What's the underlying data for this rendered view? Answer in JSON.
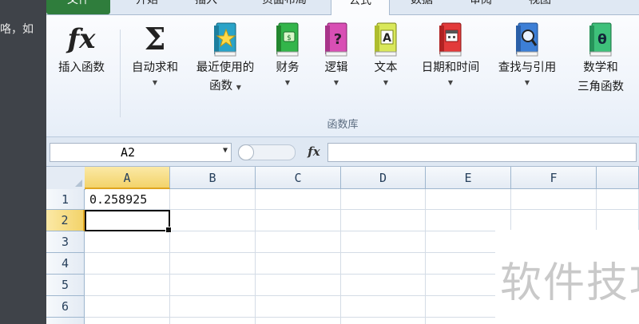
{
  "background_text": "咯，如",
  "tabs": [
    "文件",
    "开始",
    "插入",
    "页面布局",
    "公式",
    "数据",
    "审阅",
    "视图"
  ],
  "active_tab": "公式",
  "ribbon": {
    "buttons": [
      {
        "label": "插入函数",
        "icon": "insert-function-fx-icon",
        "dropdown": false
      },
      {
        "label": "自动求和",
        "icon": "autosum-sigma-icon",
        "dropdown": true
      },
      {
        "label": "最近使用的",
        "label2": "函数",
        "icon": "book-star-icon",
        "dropdown": true
      },
      {
        "label": "财务",
        "icon": "book-finance-icon",
        "dropdown": true
      },
      {
        "label": "逻辑",
        "icon": "book-question-icon",
        "dropdown": true
      },
      {
        "label": "文本",
        "icon": "book-text-a-icon",
        "dropdown": true
      },
      {
        "label": "日期和时间",
        "icon": "book-calendar-icon",
        "dropdown": true
      },
      {
        "label": "查找与引用",
        "icon": "book-magnifier-icon",
        "dropdown": true
      },
      {
        "label": "数学和",
        "label2": "三角函数",
        "icon": "book-theta-icon",
        "dropdown": false
      }
    ],
    "group_label": "函数库",
    "dropdown_glyph": "▼"
  },
  "formula_bar": {
    "name_box": "A2",
    "fx_label": "fx",
    "formula": ""
  },
  "grid": {
    "columns": [
      "A",
      "B",
      "C",
      "D",
      "E",
      "F"
    ],
    "rows": [
      "1",
      "2",
      "3",
      "4",
      "5",
      "6"
    ],
    "cells": {
      "A1": "0.258925"
    },
    "selected_cell": "A2"
  },
  "watermark": "软件技巧",
  "colors": {
    "file_tab": "#2f7d3c",
    "selection_header": "#f3d36a",
    "ribbon_bg": "#f1f5fb"
  }
}
